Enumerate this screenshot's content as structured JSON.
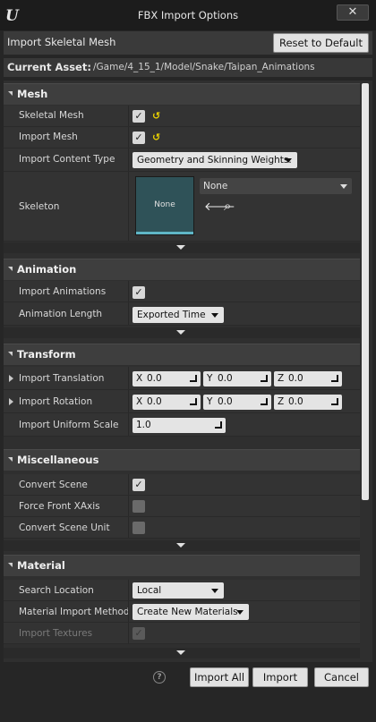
{
  "window": {
    "title": "FBX Import Options",
    "close_glyph": "✕"
  },
  "header": {
    "title": "Import Skeletal Mesh",
    "reset_label": "Reset to Default"
  },
  "asset": {
    "label": "Current Asset:",
    "path": "/Game/4_15_1/Model/Snake/Taipan_Animations"
  },
  "categories": {
    "mesh": "Mesh",
    "animation": "Animation",
    "transform": "Transform",
    "misc": "Miscellaneous",
    "material": "Material"
  },
  "mesh": {
    "skeletal_mesh_label": "Skeletal Mesh",
    "skeletal_mesh_checked": true,
    "import_mesh_label": "Import Mesh",
    "import_mesh_checked": true,
    "content_type_label": "Import Content Type",
    "content_type_value": "Geometry and Skinning Weights.",
    "skeleton_label": "Skeleton",
    "skeleton_thumb_text": "None",
    "skeleton_value": "None"
  },
  "animation": {
    "import_label": "Import Animations",
    "import_checked": true,
    "length_label": "Animation Length",
    "length_value": "Exported Time"
  },
  "transform": {
    "translation_label": "Import Translation",
    "translation": {
      "x": "0.0",
      "y": "0.0",
      "z": "0.0"
    },
    "rotation_label": "Import Rotation",
    "rotation": {
      "x": "0.0",
      "y": "0.0",
      "z": "0.0"
    },
    "scale_label": "Import Uniform Scale",
    "scale_value": "1.0",
    "axis_x": "X",
    "axis_y": "Y",
    "axis_z": "Z"
  },
  "misc": {
    "convert_scene_label": "Convert Scene",
    "convert_scene_checked": true,
    "force_front_label": "Force Front XAxis",
    "force_front_checked": false,
    "convert_unit_label": "Convert Scene Unit",
    "convert_unit_checked": false
  },
  "material": {
    "search_label": "Search Location",
    "search_value": "Local",
    "method_label": "Material Import Method",
    "method_value": "Create New Materials",
    "textures_label": "Import Textures",
    "textures_checked": true
  },
  "footer": {
    "help_glyph": "?",
    "import_all_label": "Import All",
    "import_label": "Import",
    "cancel_label": "Cancel"
  },
  "icons": {
    "check": "✓",
    "reset_arrow": "↺",
    "back_arrow": "🡐",
    "search": "⌕"
  },
  "colors": {
    "accent_thumb": "#2f5258",
    "thumb_strip": "#5fb6c6",
    "reset_arrow": "#e8d000"
  }
}
